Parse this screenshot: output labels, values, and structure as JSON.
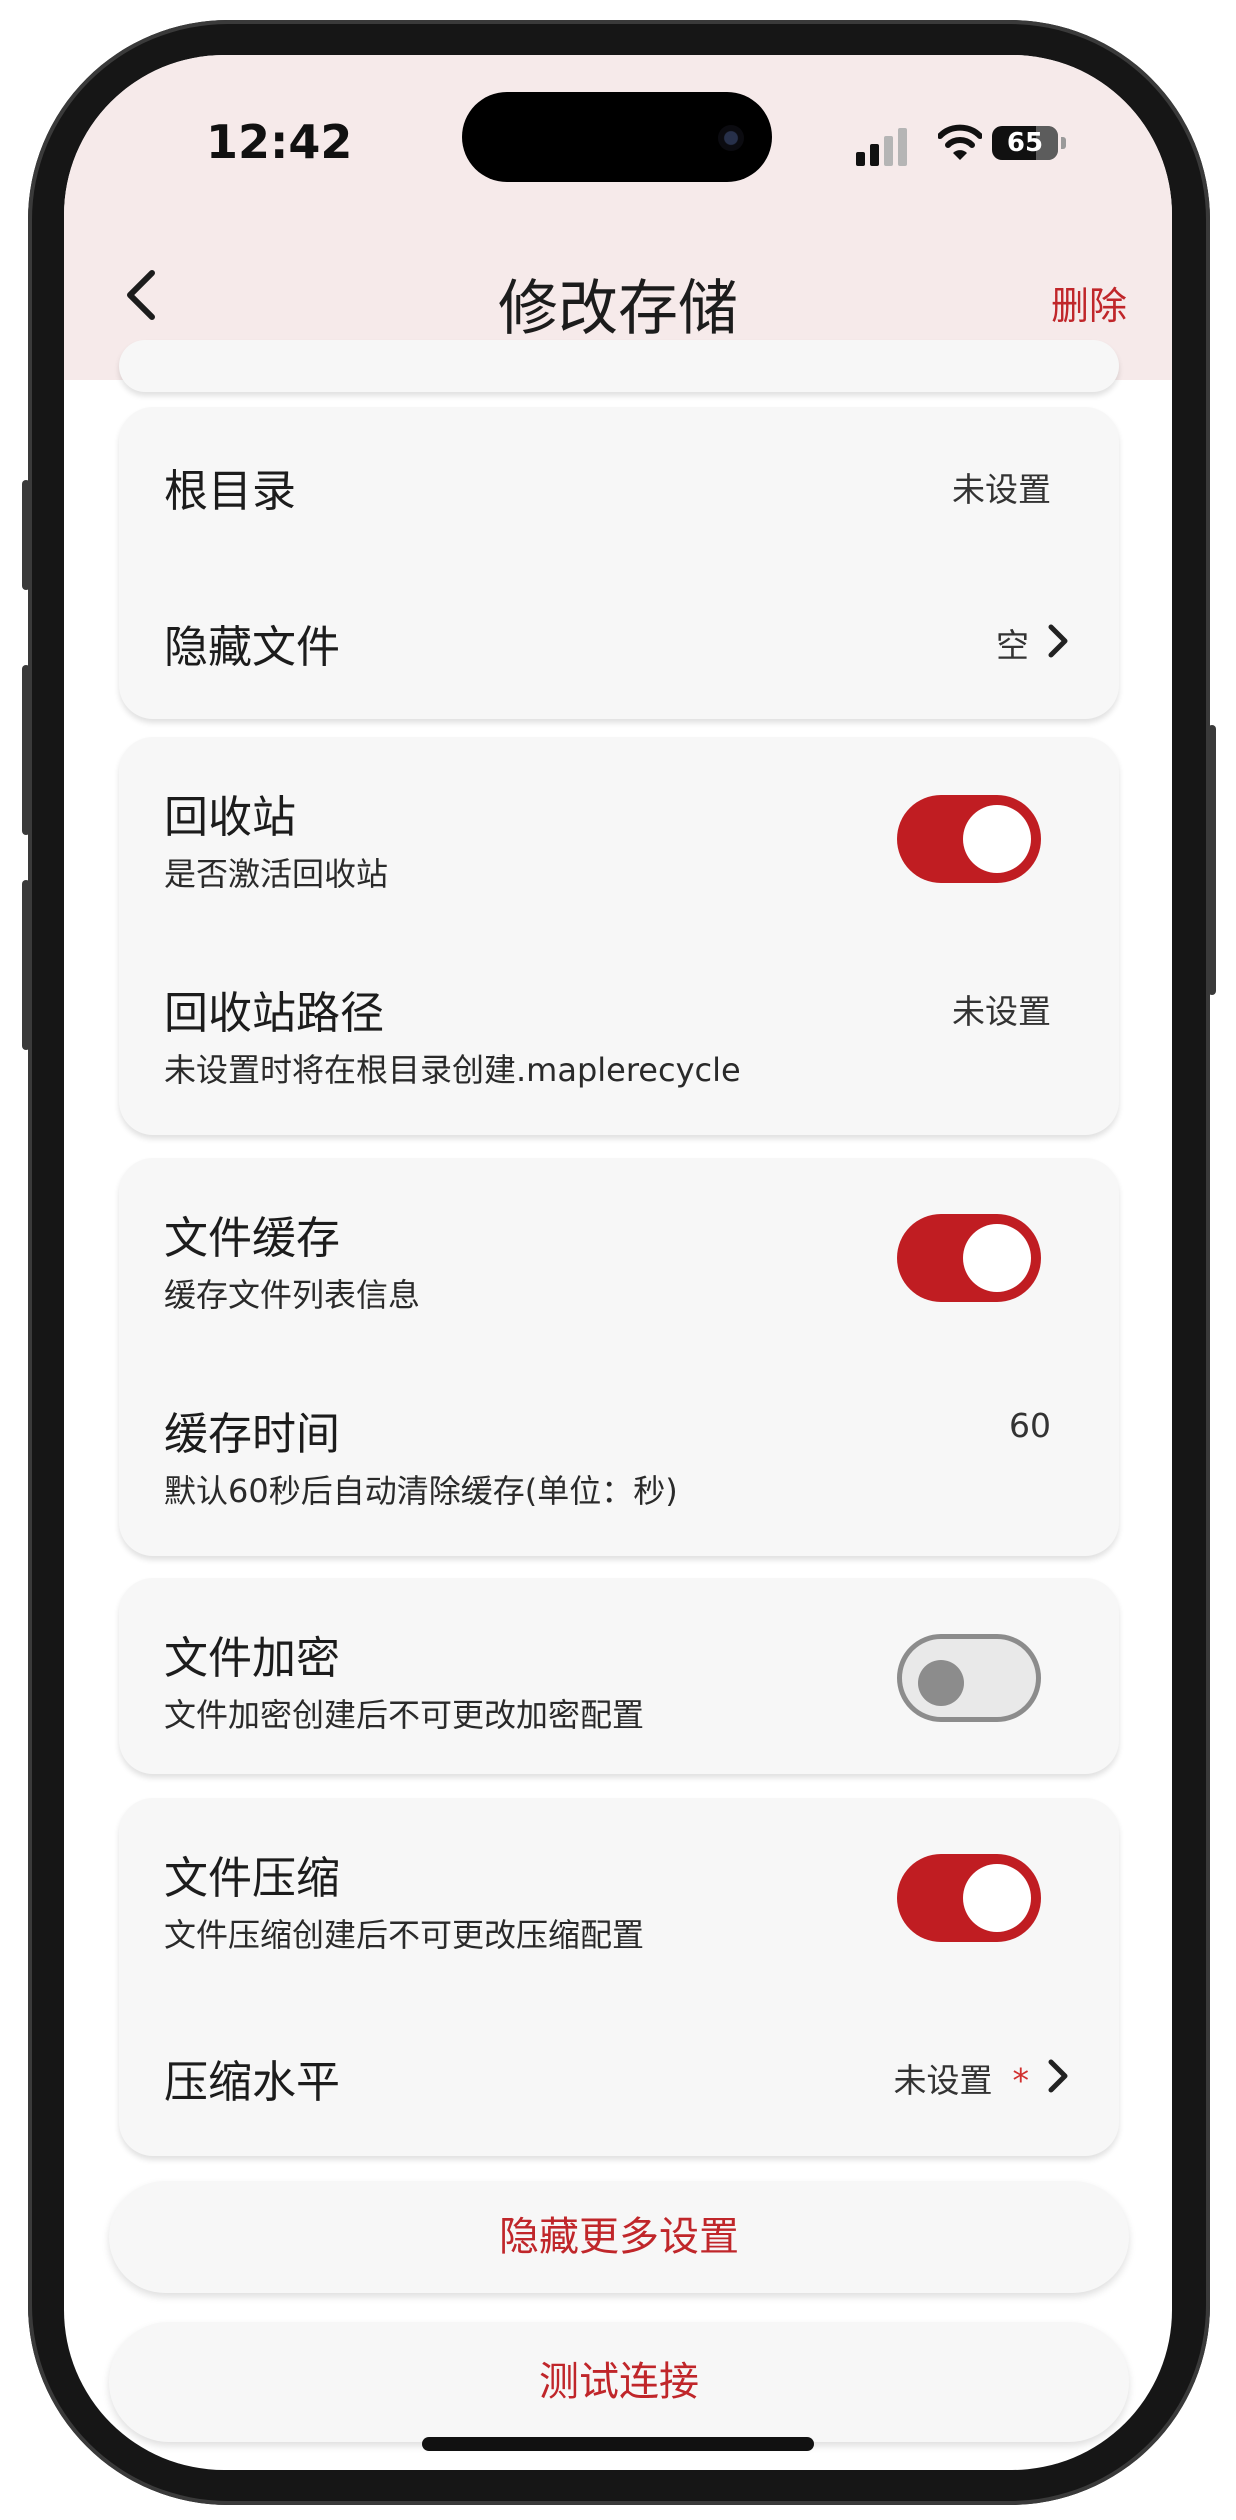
{
  "status_bar": {
    "time": "12:42",
    "battery": "65"
  },
  "appbar": {
    "title": "修改存储",
    "delete_label": "删除"
  },
  "storage": {
    "root_dir": {
      "label": "根目录",
      "value": "未设置"
    },
    "hidden_files": {
      "label": "隐藏文件",
      "value": "空"
    }
  },
  "recycle": {
    "toggle_label": "回收站",
    "toggle_desc": "是否激活回收站",
    "enabled": true,
    "path_label": "回收站路径",
    "path_desc": "未设置时将在根目录创建.maplerecycle",
    "path_value": "未设置"
  },
  "cache": {
    "toggle_label": "文件缓存",
    "toggle_desc": "缓存文件列表信息",
    "enabled": true,
    "time_label": "缓存时间",
    "time_desc": "默认60秒后自动清除缓存(单位：秒)",
    "time_value": "60"
  },
  "encryption": {
    "toggle_label": "文件加密",
    "toggle_desc": "文件加密创建后不可更改加密配置",
    "enabled": false
  },
  "compression": {
    "toggle_label": "文件压缩",
    "toggle_desc": "文件压缩创建后不可更改压缩配置",
    "enabled": true,
    "level_label": "压缩水平",
    "level_value": "未设置",
    "required_mark": "*"
  },
  "actions": {
    "hide_more": "隐藏更多设置",
    "test_connection": "测试连接"
  },
  "colors": {
    "accent": "#c0262a",
    "toggle_on": "#c01d22",
    "appbar_bg": "#f6eaea",
    "card_bg": "#f7f7f7"
  }
}
